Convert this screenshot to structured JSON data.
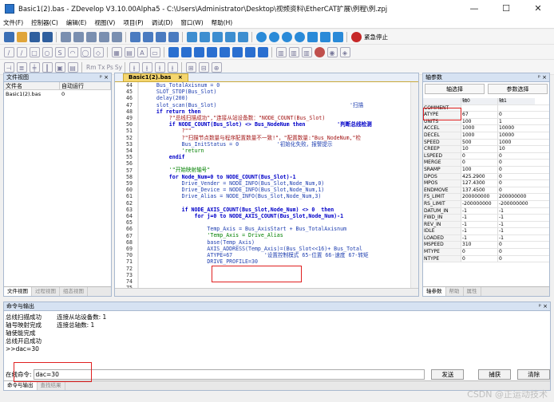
{
  "window": {
    "title": "Basic1(2).bas - ZDevelop V3.10.00Alpha5 - C:\\Users\\Administrator\\Desktop\\视频资料\\EtherCAT扩展\\例程\\例.zpj",
    "min": "—",
    "max": "☐",
    "close": "✕"
  },
  "menu": [
    "文件(F)",
    "控制器(C)",
    "编辑(E)",
    "视图(V)",
    "项目(P)",
    "调试(D)",
    "窗口(W)",
    "帮助(H)"
  ],
  "toolbar": {
    "estop_label": "紧急停止",
    "toolbar3_text": [
      "Rm",
      "Tx",
      "Ps",
      "Sy"
    ]
  },
  "left_panel": {
    "title": "文件视图",
    "pin": "ᵖ ×",
    "columns": [
      "文件名",
      "自动运行"
    ],
    "rows": [
      {
        "name": "Basic1(2).bas",
        "auto": "0"
      }
    ],
    "tabs": [
      "文件视图",
      "过程视图",
      "组态视图"
    ]
  },
  "editor": {
    "tab": "Basic1(2).bas",
    "close": "×",
    "line_numbers": [
      "44",
      "45",
      "46",
      "47",
      "48",
      "49",
      "50",
      "51",
      "52",
      "53",
      "54",
      "55",
      "56",
      "57",
      "58",
      "59",
      "60",
      "61",
      "62",
      "63",
      "64",
      "65",
      "66",
      "67",
      "68",
      "69",
      "70",
      "71",
      "72",
      "73",
      "74",
      "75"
    ],
    "lines": [
      "    Bus_TotalAxisnum = 0",
      "    SLOT_STOP(Bus_Slot)",
      "    delay(200)",
      "    slot_scan(Bus_Slot)                                          '扫描",
      "    if return then",
      "        ?\"总线扫描成功\",\"连接从站设备数：\"NODE_COUNT(Bus_Slot)",
      "        if NODE_COUNT(Bus_Slot) <> Bus_NodeNum then          '判断总线检测",
      "            ?\"\"",
      "            ?\"扫描节点数量与程序配置数量不一致!\"，\"配置数量:\"Bus_NodeNum,\"检",
      "            Bus_InitStatus = 0            '初始化失败，报警提示",
      "            'return",
      "        endif",
      "",
      "        '\"开始映射轴号\"",
      "        for Node_Num=0 to NODE_COUNT(Bus_Slot)-1",
      "            Drive_Vender = NODE_INFO(Bus_Slot,Node_Num,0)",
      "            Drive_Device = NODE_INFO(Bus_Slot,Node_Num,1)",
      "            Drive_Alias = NODE_INFO(Bus_Slot,Node_Num,3)",
      "",
      "            if NODE_AXIS_COUNT(Bus_Slot,Node_Num) <> 0  then",
      "                for j=0 to NODE_AXIS_COUNT(Bus_Slot,Node_Num)-1",
      "",
      "                    Temp_Axis = Bus_AxisStart + Bus_TotalAxisnum",
      "                    'Temp_Axis = Drive_Alias",
      "                    base(Temp_Axis)",
      "                    AXIS_ADDRESS(Temp_Axis)=(Bus_Slot<<16)+ Bus_Total",
      "                    ATYPE=67          '设置控制模式 65-位置 66-速度 67-转矩",
      "                    DRIVE_PROFILE=30",
      "",
      "",
      "",
      ""
    ]
  },
  "right_panel": {
    "title": "轴参数",
    "pin": "ᵖ ×",
    "btn_axis_select": "轴选择",
    "btn_param_select": "参数选择",
    "headers": [
      "",
      "轴0",
      "轴1"
    ],
    "rows": [
      [
        "COMMENT",
        "",
        ""
      ],
      [
        "ATYPE",
        "67",
        "0"
      ],
      [
        "UNITS",
        "100",
        "1"
      ],
      [
        "ACCEL",
        "1000",
        "10000"
      ],
      [
        "DECEL",
        "1000",
        "10000"
      ],
      [
        "SPEED",
        "500",
        "1000"
      ],
      [
        "CREEP",
        "10",
        "10"
      ],
      [
        "LSPEED",
        "0",
        "0"
      ],
      [
        "MERGE",
        "0",
        "0"
      ],
      [
        "SRAMP",
        "100",
        "0"
      ],
      [
        "DPOS",
        "425.2900",
        "0"
      ],
      [
        "MPOS",
        "127.4300",
        "0"
      ],
      [
        "ENDMOVE",
        "137.4500",
        "0"
      ],
      [
        "FS_LIMIT",
        "200000000",
        "200000000"
      ],
      [
        "RS_LIMIT",
        "-200000000",
        "-200000000"
      ],
      [
        "DATUM_IN",
        "-1",
        "-1"
      ],
      [
        "FWD_IN",
        "-1",
        "-1"
      ],
      [
        "REV_IN",
        "-1",
        "-1"
      ],
      [
        "IDLE",
        "-1",
        "-1"
      ],
      [
        "LOADED",
        "-1",
        "-1"
      ],
      [
        "MSPEED",
        "310",
        "0"
      ],
      [
        "MTYPE",
        "0",
        "0"
      ],
      [
        "NTYPE",
        "0",
        "0"
      ]
    ],
    "tabs": [
      "轴参数",
      "帮助",
      "属性"
    ]
  },
  "command_panel": {
    "title": "命令与输出",
    "pin": "ᵖ ×",
    "output_lines": [
      "总线扫描成功        连接从站设备数: 1",
      "轴号映射完成        连接总轴数: 1",
      "轴使能完成",
      "总线开启成功",
      ">>dac=30"
    ],
    "cmd_label": "在线命令:",
    "cmd_value": "dac=30",
    "send_label": "发送",
    "capture_label": "捕获",
    "clear_label": "清除",
    "tabs": [
      "命令与输出",
      "查找结果"
    ]
  },
  "watermark": "CSDN @正运动技术"
}
